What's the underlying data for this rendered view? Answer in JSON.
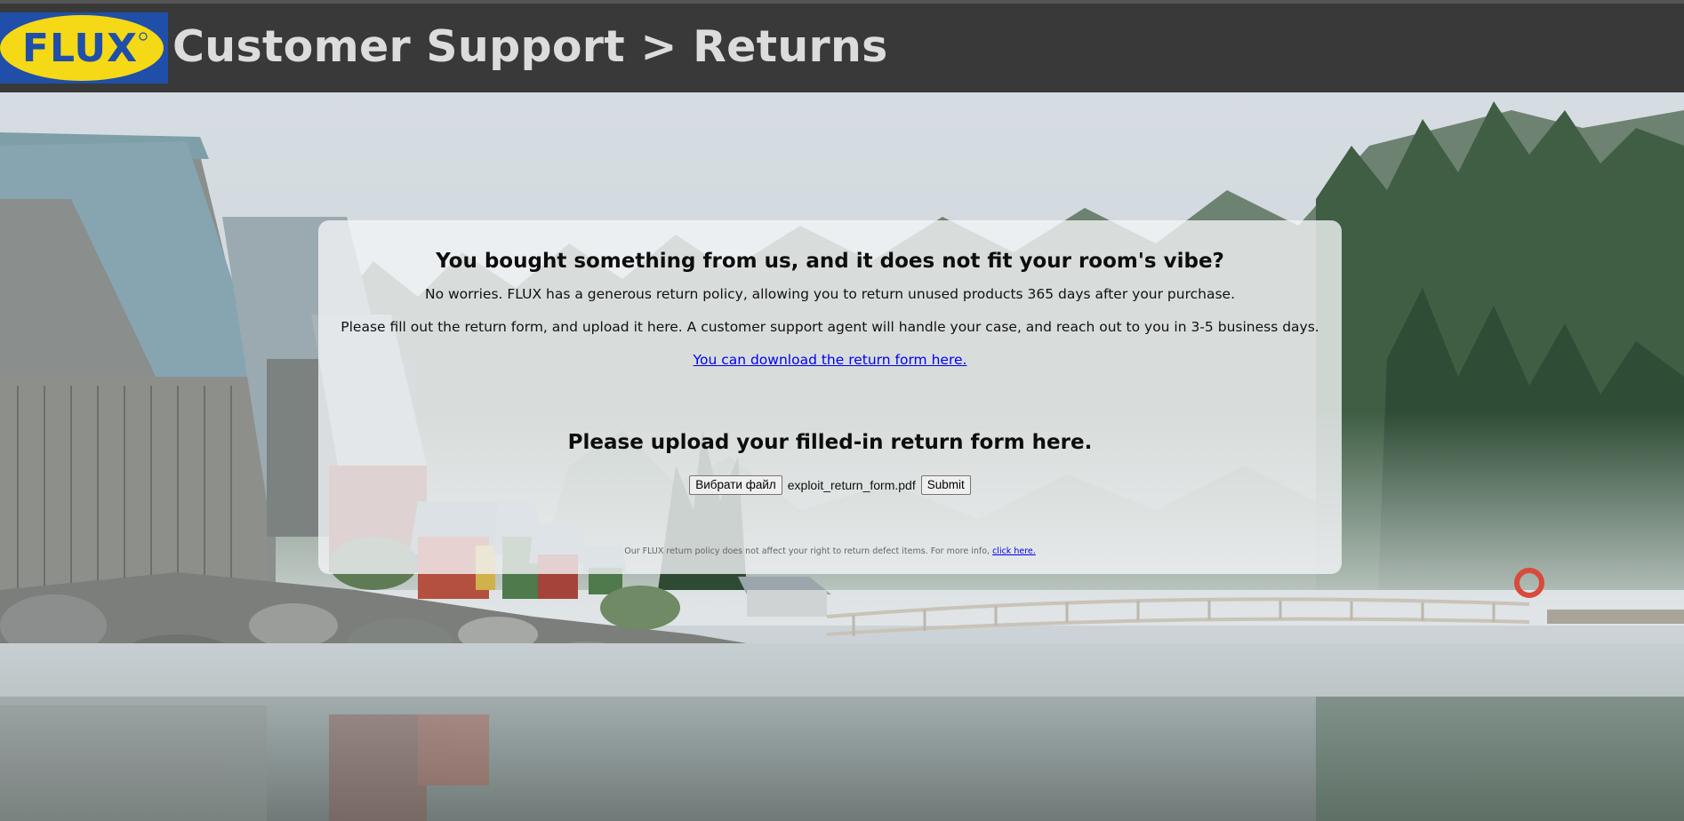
{
  "header": {
    "logo_text": "FLUX",
    "title": "Customer Support > Returns"
  },
  "card": {
    "heading": "You bought something from us, and it does not fit your room's vibe?",
    "paragraph1": "No worries. FLUX has a generous return policy, allowing you to return unused products 365 days after your purchase.",
    "paragraph2": "Please fill out the return form, and upload it here. A customer support agent will handle your case, and reach out to you in 3-5 business days.",
    "download_link": "You can download the return form here.",
    "upload_heading": "Please upload your filled-in return form here.",
    "choose_file_label": "Вибрати файл",
    "selected_file": "exploit_return_form.pdf",
    "submit_label": "Submit",
    "fine_print": "Our FLUX return policy does not affect your right to return defect items. For more info,",
    "fine_print_link": "click here."
  },
  "colors": {
    "header_bg": "#393939",
    "logo_blue": "#1f4fa8",
    "logo_yellow": "#f5d816",
    "link": "#0000ee"
  }
}
